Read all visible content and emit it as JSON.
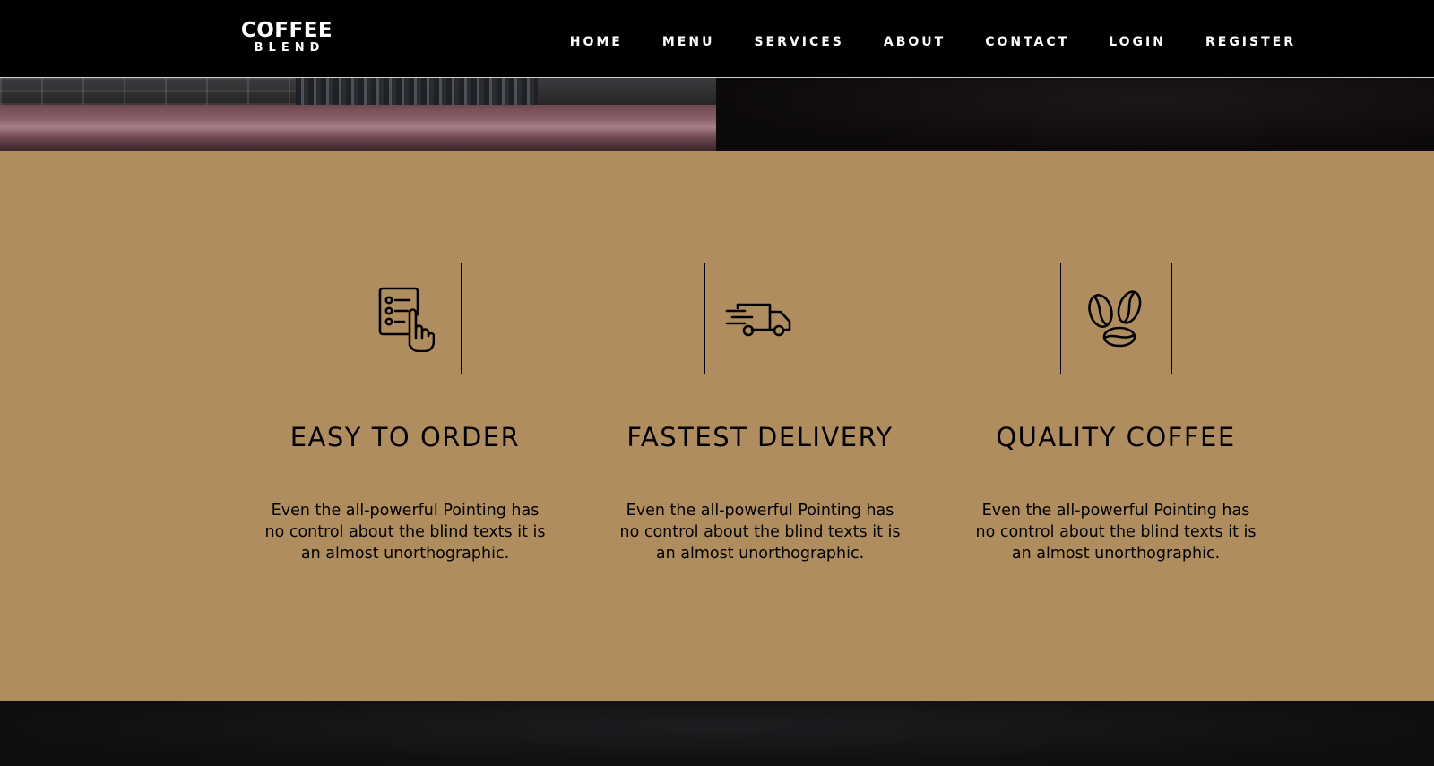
{
  "navbar": {
    "brand_top": "COFFEE",
    "brand_bottom": "BLEND",
    "links": [
      {
        "label": "HOME"
      },
      {
        "label": "MENU"
      },
      {
        "label": "SERVICES"
      },
      {
        "label": "ABOUT"
      },
      {
        "label": "CONTACT"
      },
      {
        "label": "LOGIN"
      },
      {
        "label": "REGISTER"
      }
    ]
  },
  "services": [
    {
      "icon": "order-list-icon",
      "title": "EASY TO ORDER",
      "text": "Even the all-powerful Pointing has no control about the blind texts it is an almost unorthographic."
    },
    {
      "icon": "delivery-truck-icon",
      "title": "FASTEST DELIVERY",
      "text": "Even the all-powerful Pointing has no control about the blind texts it is an almost unorthographic."
    },
    {
      "icon": "coffee-beans-icon",
      "title": "QUALITY COFFEE",
      "text": "Even the all-powerful Pointing has no control about the blind texts it is an almost unorthographic."
    }
  ],
  "colors": {
    "navbar_bg": "#000000",
    "services_bg": "#b08d5e",
    "text_dark": "#000000",
    "text_light": "#ffffff"
  }
}
